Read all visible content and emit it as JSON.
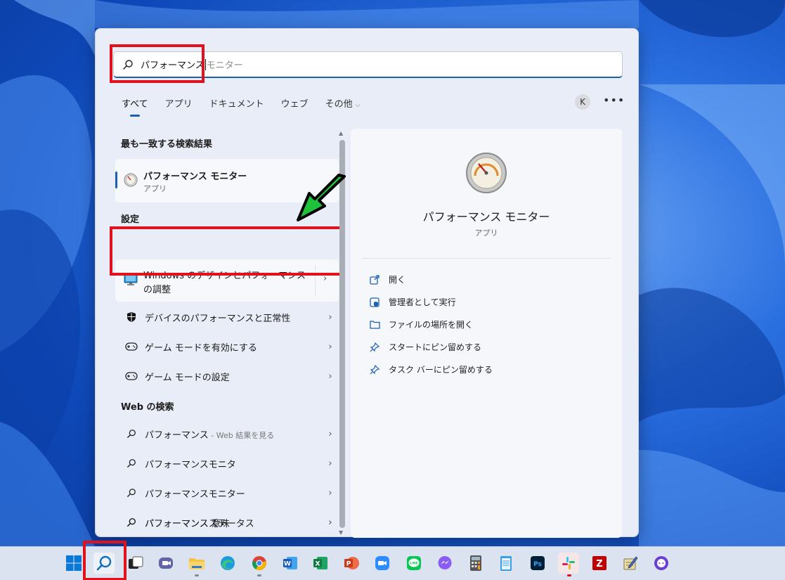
{
  "search": {
    "typed": "パフォーマンス",
    "suggestion": "モニター"
  },
  "tabs": [
    {
      "label": "すべて",
      "active": true
    },
    {
      "label": "アプリ"
    },
    {
      "label": "ドキュメント"
    },
    {
      "label": "ウェブ"
    },
    {
      "label": "その他"
    }
  ],
  "account_initial": "K",
  "more_label": "•••",
  "sections": {
    "best_match": "最も一致する検索結果",
    "settings": "設定",
    "web": "Web の検索"
  },
  "best_match": {
    "title": "パフォーマンス モニター",
    "type": "アプリ"
  },
  "settings_items": [
    "Windows のデザインとパフォーマンスの調整",
    "デバイスのパフォーマンスと正常性",
    "ゲーム モードを有効にする",
    "ゲーム モードの設定"
  ],
  "web_items": [
    {
      "label": "パフォーマンス",
      "sub": " - Web 結果を見る"
    },
    {
      "label": "パフォーマンスモニタ",
      "sub": ""
    },
    {
      "label": "パフォーマンスモニター",
      "sub": ""
    },
    {
      "label": "パフォーマンス 意味",
      "sub": ""
    },
    {
      "label": "パフォーマンスステータス",
      "sub": ""
    }
  ],
  "preview": {
    "title": "パフォーマンス モニター",
    "subtitle": "アプリ",
    "actions": [
      "開く",
      "管理者として実行",
      "ファイルの場所を開く",
      "スタートにピン留めする",
      "タスク バーにピン留めする"
    ]
  },
  "colors": {
    "highlight_box": "#e2121c",
    "accent": "#1a5fb4",
    "arrow": "#1fc23a"
  },
  "taskbar_icons": [
    "start-icon",
    "search-icon",
    "task-view-icon",
    "teams-chat-icon",
    "file-explorer-icon",
    "edge-icon",
    "chrome-icon",
    "word-icon",
    "excel-icon",
    "powerpoint-icon",
    "zoom-icon",
    "line-icon",
    "messenger-icon",
    "calculator-icon",
    "notepad-icon",
    "photoshop-icon",
    "slack-icon",
    "filezilla-icon",
    "notepad-pen-icon",
    "chat-bubble-icon"
  ]
}
